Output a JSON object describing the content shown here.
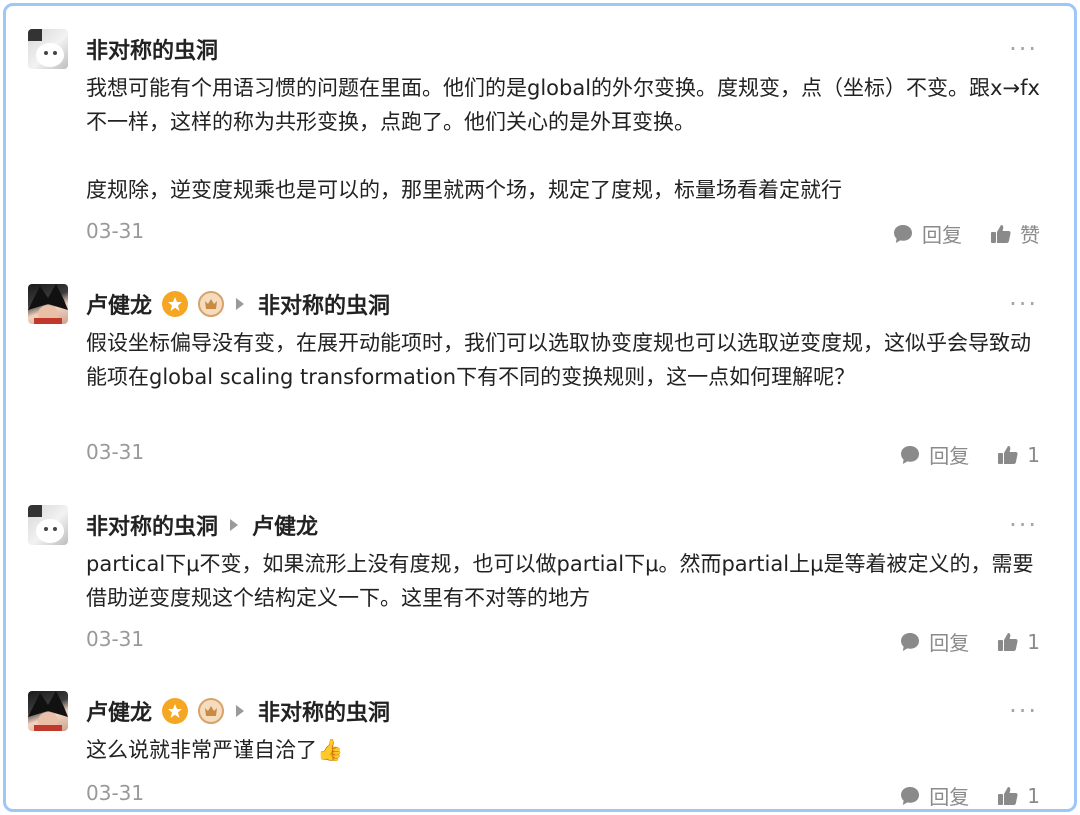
{
  "comments": [
    {
      "avatar": "cat-avatar",
      "author": "非对称的虫洞",
      "reply_to": null,
      "text": "我想可能有个用语习惯的问题在里面。他们的是global的外尔变换。度规变，点（坐标）不变。跟x→fx不一样，这样的称为共形变换，点跑了。他们关心的是外耳变换。\n\n度规除，逆变度规乘也是可以的，那里就两个场，规定了度规，标量场看着定就行",
      "date": "03-31",
      "reply_label": "回复",
      "like_label": "赞",
      "like_count": null
    },
    {
      "avatar": "goku-avatar",
      "author": "卢健龙",
      "reply_to": "非对称的虫洞",
      "text": "假设坐标偏导没有变，在展开动能项时，我们可以选取协变度规也可以选取逆变度规，这似乎会导致动能项在global scaling transformation下有不同的变换规则，这一点如何理解呢？",
      "date": "03-31",
      "reply_label": "回复",
      "like_label": null,
      "like_count": "1"
    },
    {
      "avatar": "cat-avatar",
      "author": "非对称的虫洞",
      "reply_to": "卢健龙",
      "text": "partical下μ不变，如果流形上没有度规，也可以做partial下μ。然而partial上μ是等着被定义的，需要借助逆变度规这个结构定义一下。这里有不对等的地方",
      "date": "03-31",
      "reply_label": "回复",
      "like_label": null,
      "like_count": "1"
    },
    {
      "avatar": "goku-avatar",
      "author": "卢健龙",
      "reply_to": "非对称的虫洞",
      "text": "这么说就非常严谨自洽了👍",
      "date": "03-31",
      "reply_label": "回复",
      "like_label": null,
      "like_count": "1"
    }
  ],
  "more_label": "···",
  "icons": {
    "reply": "speech-bubble-icon",
    "like": "thumbs-up-icon",
    "badge_a": "star-badge-icon",
    "badge_b": "crown-badge-icon",
    "caret": "caret-right-icon"
  }
}
